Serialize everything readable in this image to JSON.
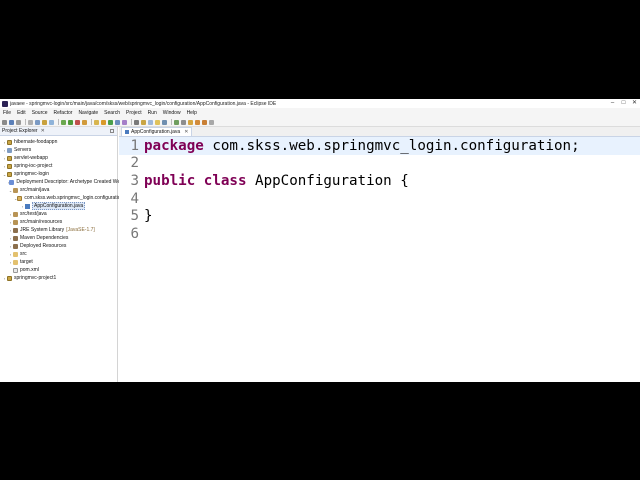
{
  "window": {
    "title": "javaee - springmvc-login/src/main/java/com/skss/web/springmvc_login/configuration/AppConfiguration.java - Eclipse IDE",
    "controls": [
      "–",
      "□",
      "✕"
    ]
  },
  "menu": [
    "File",
    "Edit",
    "Source",
    "Refactor",
    "Navigate",
    "Search",
    "Project",
    "Run",
    "Window",
    "Help"
  ],
  "explorer": {
    "title": "Project Explorer",
    "close": "✕",
    "items": [
      {
        "label": "hibernate-foodappn",
        "arrow": "›",
        "icon": "proj",
        "indent": 0
      },
      {
        "label": "Servers",
        "arrow": "›",
        "icon": "server",
        "indent": 0
      },
      {
        "label": "servlet-webapp",
        "arrow": "›",
        "icon": "proj",
        "indent": 0
      },
      {
        "label": "spring-ioc-project",
        "arrow": "›",
        "icon": "proj",
        "indent": 0
      },
      {
        "label": "springmvc-login",
        "arrow": "⌄",
        "icon": "proj",
        "indent": 0
      },
      {
        "label": "Deployment Descriptor: Archetype Created Web Application",
        "arrow": "›",
        "icon": "desc",
        "indent": 1
      },
      {
        "label": "src/main/java",
        "arrow": "⌄",
        "icon": "pkgroot",
        "indent": 1
      },
      {
        "label": "com.skss.web.springmvc_login.configuration",
        "arrow": "⌄",
        "icon": "pkg",
        "indent": 2
      },
      {
        "label": "AppConfiguration.java",
        "arrow": "›",
        "icon": "java",
        "indent": 3,
        "selected": true
      },
      {
        "label": "src/test/java",
        "arrow": "›",
        "icon": "pkgroot",
        "indent": 1
      },
      {
        "label": "src/main/resources",
        "arrow": "›",
        "icon": "pkgroot",
        "indent": 1
      },
      {
        "label": "JRE System Library",
        "suffix": "[JavaSE-1.7]",
        "arrow": "›",
        "icon": "lib",
        "indent": 1
      },
      {
        "label": "Maven Dependencies",
        "arrow": "›",
        "icon": "lib",
        "indent": 1
      },
      {
        "label": "Deployed Resources",
        "arrow": "›",
        "icon": "lib",
        "indent": 1
      },
      {
        "label": "src",
        "arrow": "›",
        "icon": "folder",
        "indent": 1
      },
      {
        "label": "target",
        "arrow": "›",
        "icon": "folder",
        "indent": 1
      },
      {
        "label": "pom.xml",
        "arrow": "",
        "icon": "file",
        "indent": 1
      },
      {
        "label": "springmvc-project1",
        "arrow": "›",
        "icon": "proj",
        "indent": 0
      }
    ]
  },
  "editor": {
    "tab": "AppConfiguration.java",
    "tab_close": "✕",
    "current_line": 1,
    "lines": [
      {
        "num": "1",
        "kw": "package",
        "rest": " com.skss.web.springmvc_login.configuration;"
      },
      {
        "num": "2",
        "kw": "",
        "rest": ""
      },
      {
        "num": "3",
        "kw": "public class",
        "rest": " AppConfiguration {"
      },
      {
        "num": "4",
        "kw": "",
        "rest": ""
      },
      {
        "num": "5",
        "kw": "",
        "rest": "}"
      },
      {
        "num": "6",
        "kw": "",
        "rest": ""
      }
    ]
  },
  "colors": {
    "keyword": "#7f0055",
    "current_line": "#e8f2fe",
    "line_number": "#787878"
  }
}
